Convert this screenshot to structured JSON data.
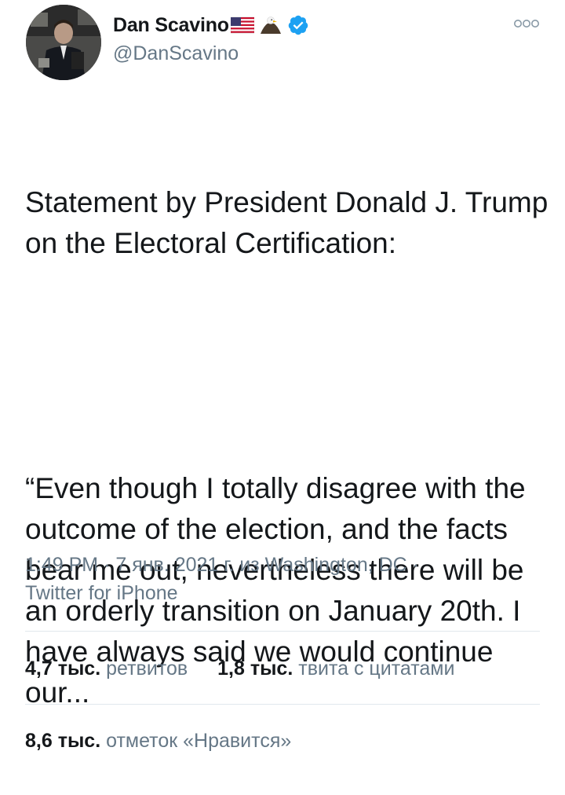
{
  "user": {
    "display_name": "Dan Scavino",
    "handle": "@DanScavino",
    "emojis": [
      "us-flag-icon",
      "eagle-icon"
    ],
    "verified": true
  },
  "tweet": {
    "paragraphs": [
      "Statement by President Donald J. Trump on the Electoral Certification:",
      "“Even though I totally disagree with the outcome of the election, and the facts bear me out, nevertheless there will be an orderly transition on January 20th. I have always said we would continue our..."
    ]
  },
  "meta": {
    "time": "1:49 PM",
    "date": "7 янв. 2021 г.",
    "location_prefix": "из",
    "location": "Washington, DC",
    "separator": "·",
    "source": "Twitter for iPhone"
  },
  "stats": {
    "retweets_count": "4,7 тыс.",
    "retweets_label": "ретвитов",
    "quotes_count": "1,8 тыс.",
    "quotes_label": "твита с цитатами",
    "likes_count": "8,6 тыс.",
    "likes_label": "отметок «Нравится»"
  },
  "colors": {
    "verified": "#1da1f2",
    "text": "#14171a",
    "secondary": "#657786",
    "divider": "#e1e8ed"
  }
}
